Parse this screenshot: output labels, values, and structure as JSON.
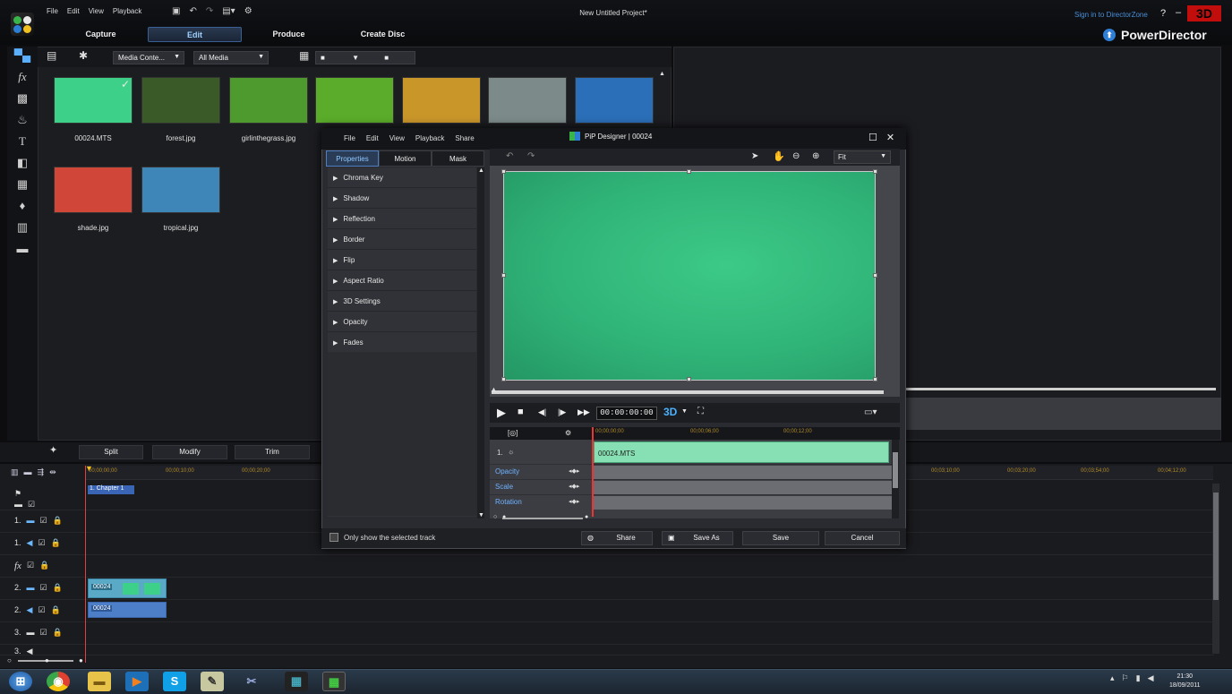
{
  "app": {
    "menu": [
      "File",
      "Edit",
      "View",
      "Playback"
    ],
    "title": "New Untitled Project*",
    "modes": [
      "Capture",
      "Edit",
      "Produce",
      "Create Disc"
    ],
    "active_mode": "Edit",
    "signin": "Sign in to DirectorZone",
    "help": "?",
    "minimize": "–",
    "badge": "3D",
    "brand": "PowerDirector",
    "colors": {
      "accent": "#3a5f93",
      "brand_red": "#c20d0d",
      "green_screen": "#30b478"
    }
  },
  "library": {
    "filter1": "Media Conte...",
    "filter2": "All Media",
    "items": [
      {
        "name": "00024.MTS",
        "color": "#3dd089"
      },
      {
        "name": "forest.jpg",
        "color": "#3a5a28"
      },
      {
        "name": "girlinthegrass.jpg",
        "color": "#4f9a2e"
      },
      {
        "name": "",
        "color": "#5aac2a"
      },
      {
        "name": "",
        "color": "#c9962a"
      },
      {
        "name": "",
        "color": "#7c8a8a"
      },
      {
        "name": "",
        "color": "#2b6fb8"
      },
      {
        "name": "shade.jpg",
        "color": "#d0473a"
      },
      {
        "name": "tropical.jpg",
        "color": "#3f86b8"
      }
    ]
  },
  "editrow": {
    "split": "Split",
    "modify": "Modify",
    "trim": "Trim"
  },
  "timeline": {
    "ticks": [
      "00;00;00;00",
      "00;00;10;00",
      "00;00;20;00",
      "00;03;10;00",
      "00;03;20;00",
      "00;03;54;00",
      "00;04;12;00"
    ],
    "chapter": "1. Chapter 1",
    "tracks": [
      "",
      "1.",
      "1.",
      "fx",
      "2.",
      "2.",
      "3.",
      "3."
    ],
    "clip_video": "00024",
    "clip_audio": "00024"
  },
  "pip": {
    "menu": [
      "File",
      "Edit",
      "View",
      "Playback",
      "Share"
    ],
    "title": "PiP Designer | 00024",
    "tabs": [
      "Properties",
      "Motion",
      "Mask"
    ],
    "properties": [
      "Chroma Key",
      "Shadow",
      "Reflection",
      "Border",
      "Flip",
      "Aspect Ratio",
      "3D Settings",
      "Opacity",
      "Fades"
    ],
    "zoom": "Fit",
    "timecode": "00:00:00:00",
    "mode3d": "3D",
    "tl_clip": "00024.MTS",
    "tl_track": "1.",
    "tl_ticks": [
      "00;00;00;00",
      "00;00;06;00",
      "00;00;12;00"
    ],
    "keyframes": [
      "Opacity",
      "Scale",
      "Rotation"
    ],
    "only_selected": "Only show the selected track",
    "share": "Share",
    "save_as": "Save As",
    "save": "Save",
    "cancel": "Cancel"
  },
  "taskbar": {
    "time": "21:30",
    "date": "18/09/2011"
  }
}
